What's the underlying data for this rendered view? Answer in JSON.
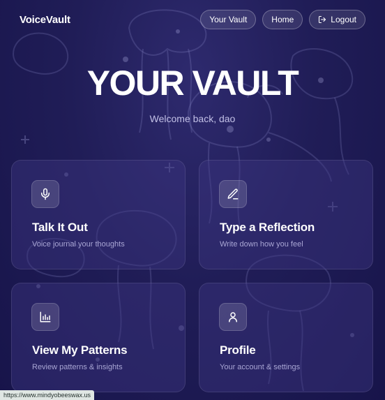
{
  "app": {
    "brand": "VoiceVault"
  },
  "nav": {
    "vault_label": "Your Vault",
    "home_label": "Home",
    "logout_label": "Logout"
  },
  "hero": {
    "title": "YOUR VAULT",
    "welcome": "Welcome back, dao"
  },
  "cards": [
    {
      "title": "Talk It Out",
      "description": "Voice journal your thoughts",
      "icon": "microphone-icon"
    },
    {
      "title": "Type a Reflection",
      "description": "Write down how you feel",
      "icon": "pen-icon"
    },
    {
      "title": "View My Patterns",
      "description": "Review patterns & insights",
      "icon": "bar-chart-icon"
    },
    {
      "title": "Profile",
      "description": "Your account & settings",
      "icon": "user-icon"
    }
  ],
  "status_bar": {
    "url": "https://www.mindyobeeswax.us"
  },
  "colors": {
    "background": "#201d57",
    "card": "#3e3882",
    "muted_text": "#a9a6d4"
  }
}
